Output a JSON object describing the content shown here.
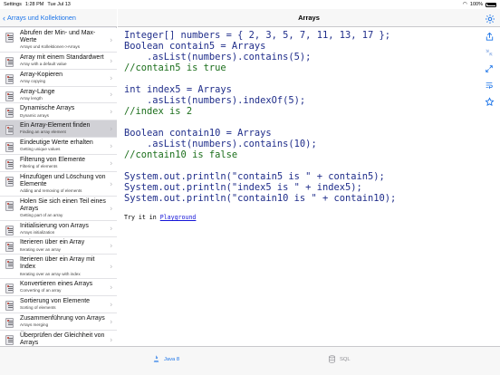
{
  "status": {
    "carrier": "Settings",
    "time": "1:28 PM",
    "date": "Tue Jul 13",
    "battery": "100%"
  },
  "sidebar": {
    "back_label": "Arrays und Kollektionen",
    "items": [
      {
        "title": "Abrufen der Min- und Max-Werte",
        "sub": "Arrays und Kollektionen->Arrays",
        "active": false
      },
      {
        "title": "Array mit einem Standardwert",
        "sub": "Array with a default value",
        "active": false
      },
      {
        "title": "Array-Kopieren",
        "sub": "Array copying",
        "active": false
      },
      {
        "title": "Array-Länge",
        "sub": "Array length",
        "active": false
      },
      {
        "title": "Dynamische Arrays",
        "sub": "Dynamic arrays",
        "active": false
      },
      {
        "title": "Ein Array-Element finden",
        "sub": "Finding an array element",
        "active": true
      },
      {
        "title": "Eindeutige Werte erhalten",
        "sub": "Getting unique values",
        "active": false
      },
      {
        "title": "Filterung von Elemente",
        "sub": "Filtering of elements",
        "active": false
      },
      {
        "title": "Hinzufügen und Löschung von Elemente",
        "sub": "Adding and removing of elements",
        "active": false
      },
      {
        "title": "Holen Sie sich einen Teil eines Arrays",
        "sub": "Getting part of an array",
        "active": false
      },
      {
        "title": "Initialisierung von Arrays",
        "sub": "Arrays initialization",
        "active": false
      },
      {
        "title": "Iterieren über ein Array",
        "sub": "Iterating over an array",
        "active": false
      },
      {
        "title": "Iterieren über ein Array mit Index",
        "sub": "Iterating over an array with index",
        "active": false
      },
      {
        "title": "Konvertieren eines Arrays",
        "sub": "Converting of an array",
        "active": false
      },
      {
        "title": "Sortierung von Elemente",
        "sub": "Sorting of elements",
        "active": false
      },
      {
        "title": "Zusammenführung von Arrays",
        "sub": "Arrays merging",
        "active": false
      },
      {
        "title": "Überprüfen der Gleichheit von Arrays",
        "sub": "",
        "active": false
      }
    ]
  },
  "detail": {
    "title": "Arrays",
    "code": [
      {
        "text": "Integer[] numbers = { 2, 3, 5, 7, 11, 13, 17 };",
        "kind": "k"
      },
      {
        "text": "Boolean contain5 = Arrays",
        "kind": "k"
      },
      {
        "text": "    .asList(numbers).contains(5);",
        "kind": "k"
      },
      {
        "text": "//contain5 is true",
        "kind": "c"
      },
      {
        "text": "",
        "kind": "gap"
      },
      {
        "text": "int index5 = Arrays",
        "kind": "k"
      },
      {
        "text": "    .asList(numbers).indexOf(5);",
        "kind": "k"
      },
      {
        "text": "//index is 2",
        "kind": "c"
      },
      {
        "text": "",
        "kind": "gap"
      },
      {
        "text": "Boolean contain10 = Arrays",
        "kind": "k"
      },
      {
        "text": "    .asList(numbers).contains(10);",
        "kind": "k"
      },
      {
        "text": "//contain10 is false",
        "kind": "c"
      },
      {
        "text": "",
        "kind": "gap"
      },
      {
        "text": "System.out.println(\"contain5 is \" + contain5);",
        "kind": "k"
      },
      {
        "text": "System.out.println(\"index5 is \" + index5);",
        "kind": "k"
      },
      {
        "text": "System.out.println(\"contain10 is \" + contain10);",
        "kind": "k"
      }
    ],
    "try_text": "Try it in ",
    "try_link": "Playground"
  },
  "tabs": {
    "java": "Java 8",
    "sql": "SQL"
  },
  "colors": {
    "accent": "#1a73e8",
    "code_keyword": "#1f2d8a",
    "code_comment": "#1b6e1b",
    "selected_row": "#d1d1d6"
  },
  "icons": [
    "gear-icon",
    "share-icon",
    "collapse-icon",
    "expand-icon",
    "wrap-icon",
    "star-icon",
    "java-icon",
    "database-icon"
  ]
}
